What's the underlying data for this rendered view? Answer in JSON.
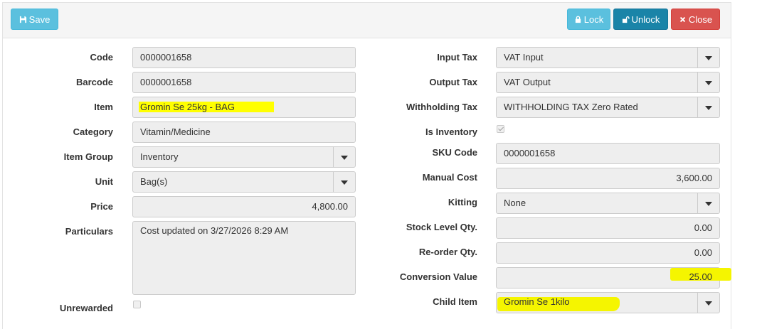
{
  "toolbar": {
    "save_label": "Save",
    "lock_label": "Lock",
    "unlock_label": "Unlock",
    "close_label": "Close"
  },
  "left": {
    "code": {
      "label": "Code",
      "value": "0000001658"
    },
    "barcode": {
      "label": "Barcode",
      "value": "0000001658"
    },
    "item": {
      "label": "Item",
      "value": "Gromin Se 25kg - BAG"
    },
    "category": {
      "label": "Category",
      "value": "Vitamin/Medicine"
    },
    "item_group": {
      "label": "Item Group",
      "value": "Inventory"
    },
    "unit": {
      "label": "Unit",
      "value": "Bag(s)"
    },
    "price": {
      "label": "Price",
      "value": "4,800.00"
    },
    "particulars": {
      "label": "Particulars",
      "value": "Cost updated on 3/27/2026 8:29 AM"
    },
    "unrewarded": {
      "label": "Unrewarded",
      "checked": false
    }
  },
  "right": {
    "input_tax": {
      "label": "Input Tax",
      "value": "VAT Input"
    },
    "output_tax": {
      "label": "Output Tax",
      "value": "VAT Output"
    },
    "withholding_tax": {
      "label": "Withholding Tax",
      "value": "WITHHOLDING TAX Zero Rated"
    },
    "is_inventory": {
      "label": "Is Inventory",
      "checked": true
    },
    "sku_code": {
      "label": "SKU Code",
      "value": "0000001658"
    },
    "manual_cost": {
      "label": "Manual Cost",
      "value": "3,600.00"
    },
    "kitting": {
      "label": "Kitting",
      "value": "None"
    },
    "stock_level_qty": {
      "label": "Stock Level Qty.",
      "value": "0.00"
    },
    "reorder_qty": {
      "label": "Re-order Qty.",
      "value": "0.00"
    },
    "conversion_value": {
      "label": "Conversion Value",
      "value": "25.00"
    },
    "child_item": {
      "label": "Child Item",
      "value": "Gromin Se 1kilo"
    }
  },
  "colors": {
    "save": "#5bc0de",
    "lock": "#5bc0de",
    "unlock": "#1a84a8",
    "close": "#d9534f",
    "highlight": "#ffff00"
  }
}
